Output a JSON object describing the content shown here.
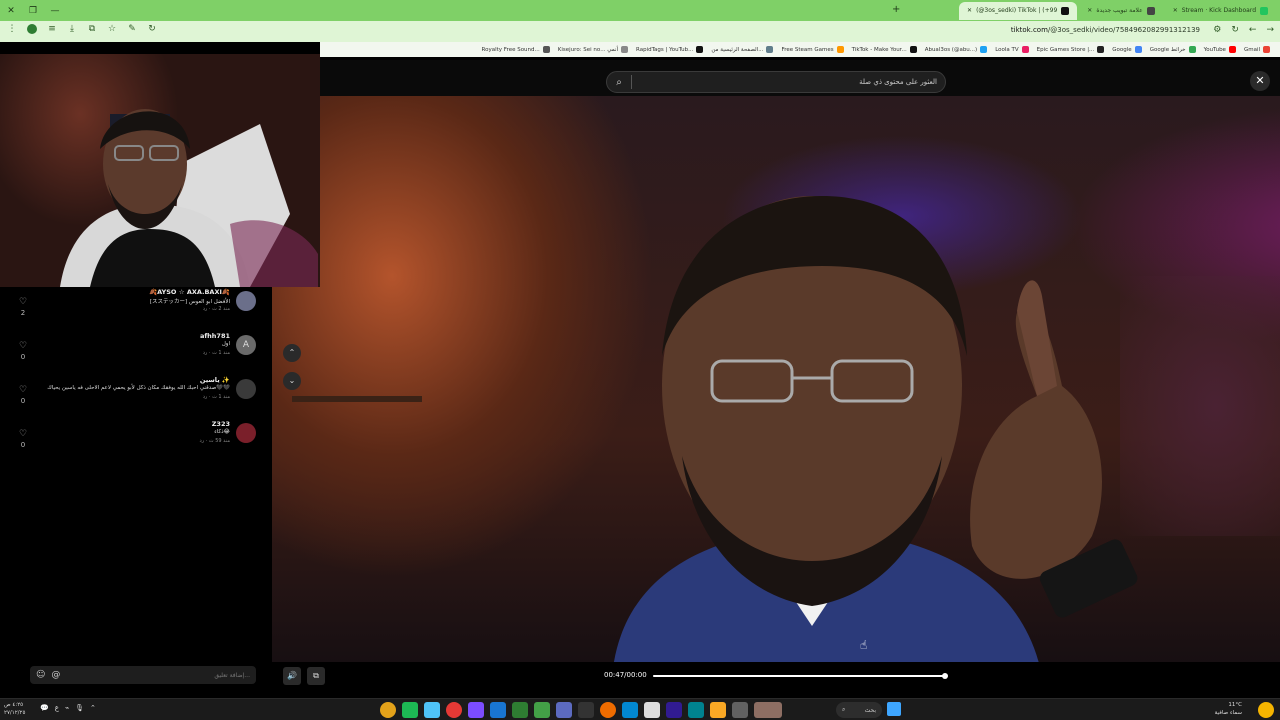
{
  "browser": {
    "tabs": [
      {
        "label": "Stream · Kick Dashboard",
        "active": false
      },
      {
        "label": "علامة تبويب جديدة",
        "active": false
      },
      {
        "label": "(@3os_sedki) TikTok | (+99",
        "active": true
      }
    ],
    "url_host": "tiktok.com",
    "url_path": "/@3os_sedki/video/7584962082991312139",
    "bookmarks": [
      "Gmail",
      "YouTube",
      "Google خرائط",
      "Google",
      "Epic Games Store |...",
      "Loola TV",
      "Abual3os (@abu...)",
      "TikTok - Make Your...",
      "Free Steam Games",
      "الصفحة الرئيسية من...",
      "RapidTags | YouTub...",
      "Kisejuro: Sei no... أنمي",
      "Royalty Free Sound..."
    ]
  },
  "search": {
    "placeholder": "العثور على محتوى ذي صلة"
  },
  "comments": [
    {
      "name": "🍂AYSO ☆ AXA.BAXI🍂",
      "text": "[スステッカー] الأفضل ابو العوس",
      "meta": "منذ 2 ث ·  رد",
      "likes": "2",
      "avatar": ""
    },
    {
      "name": "afhh781",
      "text": "اول",
      "meta": "منذ 1 ث ·  رد",
      "likes": "0",
      "avatar": "A"
    },
    {
      "name": "ياسين ✨",
      "text": "صدقني احبك الله يوفقك مكان ذكل لأبو يحمي لاعم الاحلى فه ياسين يحياك🖤🖤",
      "meta": "منذ 1 ث ·  رد",
      "likes": "0",
      "avatar": ""
    },
    {
      "name": "Z323",
      "text": "ذكاء😂",
      "meta": "منذ 59 ث ·  رد",
      "likes": "0",
      "avatar": ""
    }
  ],
  "composer": {
    "placeholder": "إضافة تعليق..."
  },
  "player": {
    "time": "00:47/00:00",
    "progress": 1.0
  },
  "taskbar": {
    "search_label": "بحث",
    "weather_temp": "11°C",
    "weather_desc": "سماء صافية",
    "clock_time": "٤:٢٥ ص",
    "clock_date": "٢٧/١٢/٢٥",
    "lang": "ع"
  },
  "colors": {
    "chrome_green": "#7fd067",
    "toolbar": "#dff5d5",
    "panel_bg": "#000000"
  }
}
